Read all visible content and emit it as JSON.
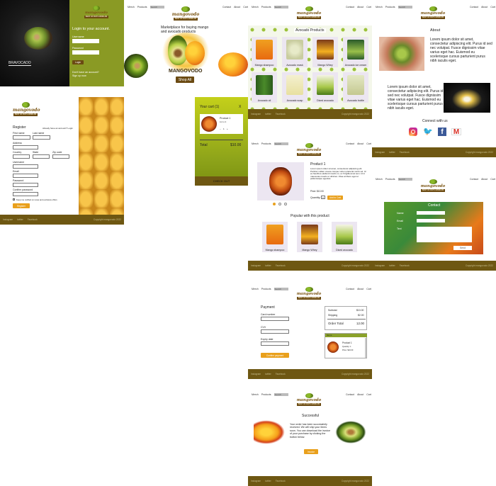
{
  "colors": {
    "brand_olive": "#8aa12a",
    "brand_brown": "#6e5712",
    "accent_orange": "#e9a01c"
  },
  "nav": {
    "search": "Search",
    "items": [
      "Contact",
      "About",
      "Cart"
    ],
    "left": [
      "Merch",
      "Products"
    ]
  },
  "logo": {
    "text": "mangovodo",
    "tagline": "BEST OF BOTH WORLDS"
  },
  "footer": {
    "links": [
      "Instagram",
      "twitter",
      "Facebook"
    ],
    "copyright": "Copyright mangovodo 2022"
  },
  "login": {
    "brand_overlay": "BRAVOCADO",
    "title": "Login to your account.",
    "username_label": "Username",
    "password_label": "Password",
    "button": "Login",
    "no_account": "Don't have an account?",
    "sign_up": "Sign up now"
  },
  "home": {
    "tagline": "Marketplace for buying mango and avocado products",
    "brand": "MANGOVODO",
    "shop_button": "Shop All"
  },
  "products": {
    "title": "Avocado Products",
    "items": [
      "Mango shampoo",
      "Avocado mask",
      "Mango Whey",
      "Avocado ice cream",
      "Avocado oil",
      "Avocado soap",
      "Diced avocado",
      "Avocado bottle"
    ]
  },
  "about": {
    "title": "About",
    "lorem1": "Lorem ipsum dolor sit amet, consectetur adipiscing elit. Purus id sed nec volutpat. Fusce dignissim vitae varius eget hac. Euismod eu scelerisque cursus parturient purus nibh iaculis eget.",
    "lorem2": "Lorem ipsum dolor sit amet, consectetur adipiscing elit. Purus id sed nec volutpat. Fusce dignissim vitae varius eget hac. Euismod eu scelerisque cursus parturient purus nibh iaculis eget.",
    "connect": "Connect with us"
  },
  "register": {
    "title": "Register",
    "already": "Already have an account? Login",
    "first_name": "First name",
    "last_name": "Last name",
    "address": "Address",
    "country": "Country",
    "state": "State",
    "zip": "Zip code",
    "username": "Username",
    "email": "Email",
    "password": "Password",
    "confirm": "Confirm password",
    "notify": "Keep me notified on news and exclusive offers",
    "button": "Register"
  },
  "cart": {
    "title": "Your cart (1)",
    "close": "X",
    "product_name": "Product 1",
    "product_sub": "Extra lit",
    "qty": "1",
    "total_label": "Total",
    "total_value": "$10.00",
    "checkout": "CHECK OUT"
  },
  "product_detail": {
    "name": "Product 1",
    "description": "Lorem ipsum dolor sit amet, consectetur adipiscing elit. Porttitor nullam creare conque rutrum placerat morbi vel. Id eu faucibus eleifend mauris mi, ex fringilla amet sem. Id in maecenas mauris ut ultricies. Vitae at libero eget ut pellentesque egestas.",
    "price": "Price: $10.00",
    "quantity_label": "Quantity:",
    "quantity": "1",
    "add_button": "Add to Cart",
    "popular_title": "Popular with this product",
    "popular": [
      "Mango shampoo",
      "Mango Whey",
      "Diced avocado"
    ]
  },
  "contact": {
    "title": "Contact",
    "name": "Name",
    "email": "Email",
    "text": "Text",
    "send": "Send"
  },
  "payment": {
    "title": "Payment",
    "card": "Card number",
    "cvv": "CVV",
    "expiry": "Expiry date",
    "confirm": "Confirm payment",
    "subtotal_label": "Subtotal",
    "subtotal": "$10.00",
    "shipping_label": "Shipping",
    "shipping": "$2.00",
    "order_label": "Order Total",
    "order_total": "12.00",
    "items_label": "Items",
    "item_name": "Product 1",
    "item_qty": "Quantity: 1",
    "item_price": "Price: $10.00"
  },
  "success": {
    "title": "Successful",
    "message": "Your order has been successfully received. We will ship your items soon. You can download the invoice of your purchase by clicking the button below.",
    "button": "Invoice"
  }
}
